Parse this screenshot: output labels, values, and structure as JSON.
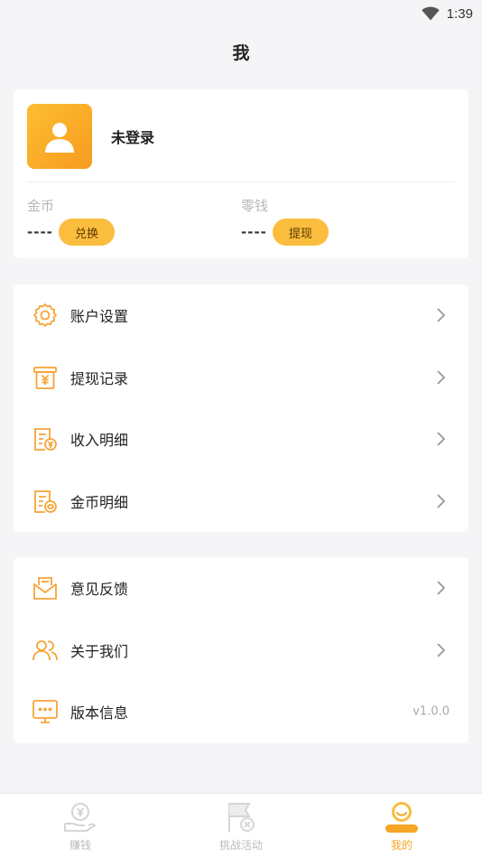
{
  "status_bar": {
    "time": "1:39",
    "wifi_icon": "wifi-icon"
  },
  "page": {
    "title": "我"
  },
  "profile": {
    "avatar_icon": "user-avatar-icon",
    "login_status": "未登录",
    "coin": {
      "label": "金币",
      "value": "----",
      "button": "兑换"
    },
    "cash": {
      "label": "零钱",
      "value": "----",
      "button": "提现"
    }
  },
  "menu_group_1": [
    {
      "label": "账户设置",
      "icon": "gear-icon"
    },
    {
      "label": "提现记录",
      "icon": "yuan-box-icon"
    },
    {
      "label": "收入明细",
      "icon": "income-detail-icon"
    },
    {
      "label": "金币明细",
      "icon": "coin-detail-icon"
    }
  ],
  "menu_group_2": [
    {
      "label": "意见反馈",
      "icon": "feedback-mail-icon"
    },
    {
      "label": "关于我们",
      "icon": "users-icon"
    },
    {
      "label": "版本信息",
      "icon": "chat-monitor-icon",
      "value": "v1.0.0"
    }
  ],
  "tab_bar": [
    {
      "label": "赚钱",
      "icon": "coin-hand-icon",
      "active": false
    },
    {
      "label": "挑战活动",
      "icon": "flag-icon",
      "active": false
    },
    {
      "label": "我的",
      "icon": "smile-profile-icon",
      "active": true
    }
  ],
  "colors": {
    "accent": "#F5A623",
    "button": "#FBBD3E",
    "icon_orange": "#F7A437"
  }
}
